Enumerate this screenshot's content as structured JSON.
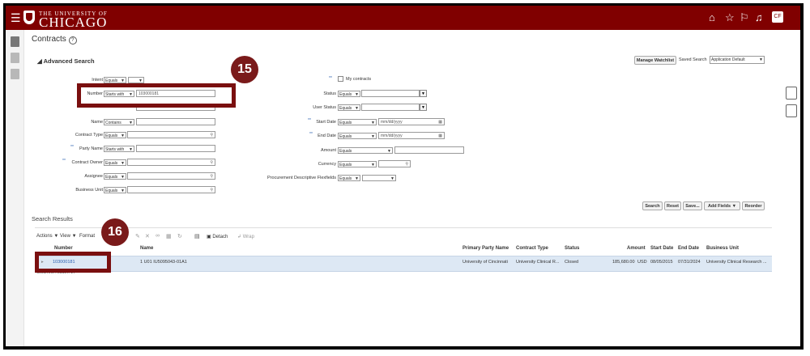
{
  "header": {
    "logo_small": "THE UNIVERSITY OF",
    "logo_big": "CHICAGO",
    "avatar_initials": "CF"
  },
  "page": {
    "title": "Contracts"
  },
  "advanced_search": {
    "heading": "Advanced Search",
    "manage_watchlist": "Manage Watchlist",
    "saved_search_label": "Saved Search",
    "saved_search_value": "Application Default",
    "fields": {
      "intent_label": "Intent",
      "intent_op": "Equals",
      "number_label": "Number",
      "number_op": "Starts with",
      "number_value": "103000181",
      "name_label": "Name",
      "name_op": "Contains",
      "contract_type_label": "Contract Type",
      "contract_type_op": "Equals",
      "party_name_label": "Party Name",
      "party_name_op": "Starts with",
      "contract_owner_label": "Contract Owner",
      "contract_owner_op": "Equals",
      "assignee_label": "Assignee",
      "assignee_op": "Equals",
      "business_unit_label": "Business Unit",
      "business_unit_op": "Equals",
      "my_contracts_label": "My contracts",
      "status_label": "Status",
      "status_op": "Equals",
      "user_status_label": "User Status",
      "user_status_op": "Equals",
      "start_date_label": "Start Date",
      "start_date_op": "Equals",
      "start_date_placeholder": "mm/dd/yyyy",
      "end_date_label": "End Date",
      "end_date_op": "Equals",
      "end_date_placeholder": "mm/dd/yyyy",
      "amount_label": "Amount",
      "amount_op": "Equals",
      "currency_label": "Currency",
      "currency_op": "Equals",
      "flexfields_label": "Procurement Descriptive Flexfields",
      "flexfields_op": "Equals"
    },
    "buttons": {
      "search": "Search",
      "reset": "Reset",
      "save": "Save...",
      "add_fields": "Add Fields",
      "reorder": "Reorder"
    }
  },
  "results": {
    "heading": "Search Results",
    "toolbar": {
      "actions": "Actions",
      "view": "View",
      "format": "Format",
      "detach": "Detach",
      "wrap": "Wrap"
    },
    "columns": [
      "Number",
      "Name",
      "Primary Party Name",
      "Contract Type",
      "Status",
      "Amount",
      "Start Date",
      "End Date",
      "Business Unit"
    ],
    "rows": [
      {
        "number": "103000181",
        "name": "1 U01 IU5095043-01A1",
        "party": "University of Cincinnati",
        "type": "University Clinical R...",
        "status": "Closed",
        "amount": "185,680.00",
        "currency": "USD",
        "start": "08/05/2015",
        "end": "07/31/2024",
        "bu": "University Clinical Research ..."
      }
    ],
    "footer": "Columns Hidden 17"
  },
  "callouts": {
    "badge_15": "15",
    "badge_16": "16"
  },
  "colors": {
    "brand": "#800000",
    "callout": "#7a0f0f",
    "row_highlight": "#dde8f4",
    "link": "#2a5fb0"
  }
}
